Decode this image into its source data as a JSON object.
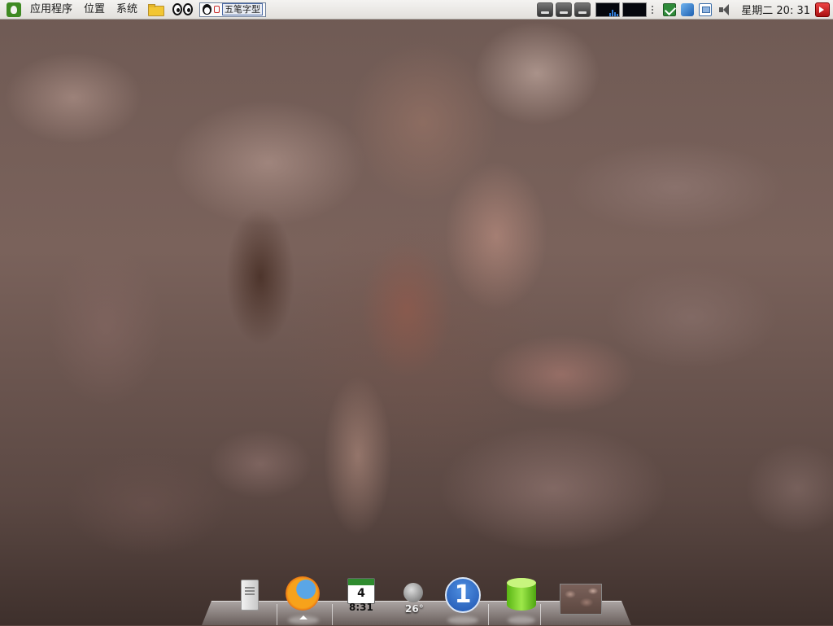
{
  "top_panel": {
    "menus": [
      "应用程序",
      "位置",
      "系统"
    ],
    "ime": {
      "label": "五笔字型"
    },
    "clock": "星期二 20: 31",
    "icons": [
      "gnome-foot-icon",
      "folder-icon",
      "eyes-icon",
      "penguin-icon",
      "lock-icon",
      "drive-icon",
      "system-monitor-icon",
      "mail-icon",
      "network-icon",
      "volume-icon",
      "logout-icon"
    ]
  },
  "dock": {
    "items": [
      {
        "name": "computer",
        "icon": "tower-icon"
      },
      {
        "name": "firefox",
        "icon": "firefox-icon"
      },
      {
        "name": "calendar",
        "icon": "calendar-icon",
        "day": "4",
        "time": "8:31"
      },
      {
        "name": "weather",
        "icon": "moon-icon",
        "temperature": "26°"
      },
      {
        "name": "workspace",
        "icon": "workspace-icon",
        "number": "1"
      },
      {
        "name": "database",
        "icon": "database-icon"
      },
      {
        "name": "wallpaper",
        "icon": "thumbnail-icon"
      }
    ]
  },
  "colors": {
    "panel_bg": "#e9e7e3",
    "workspace_blue": "#2f6fd0",
    "db_green": "#7fd32c"
  }
}
